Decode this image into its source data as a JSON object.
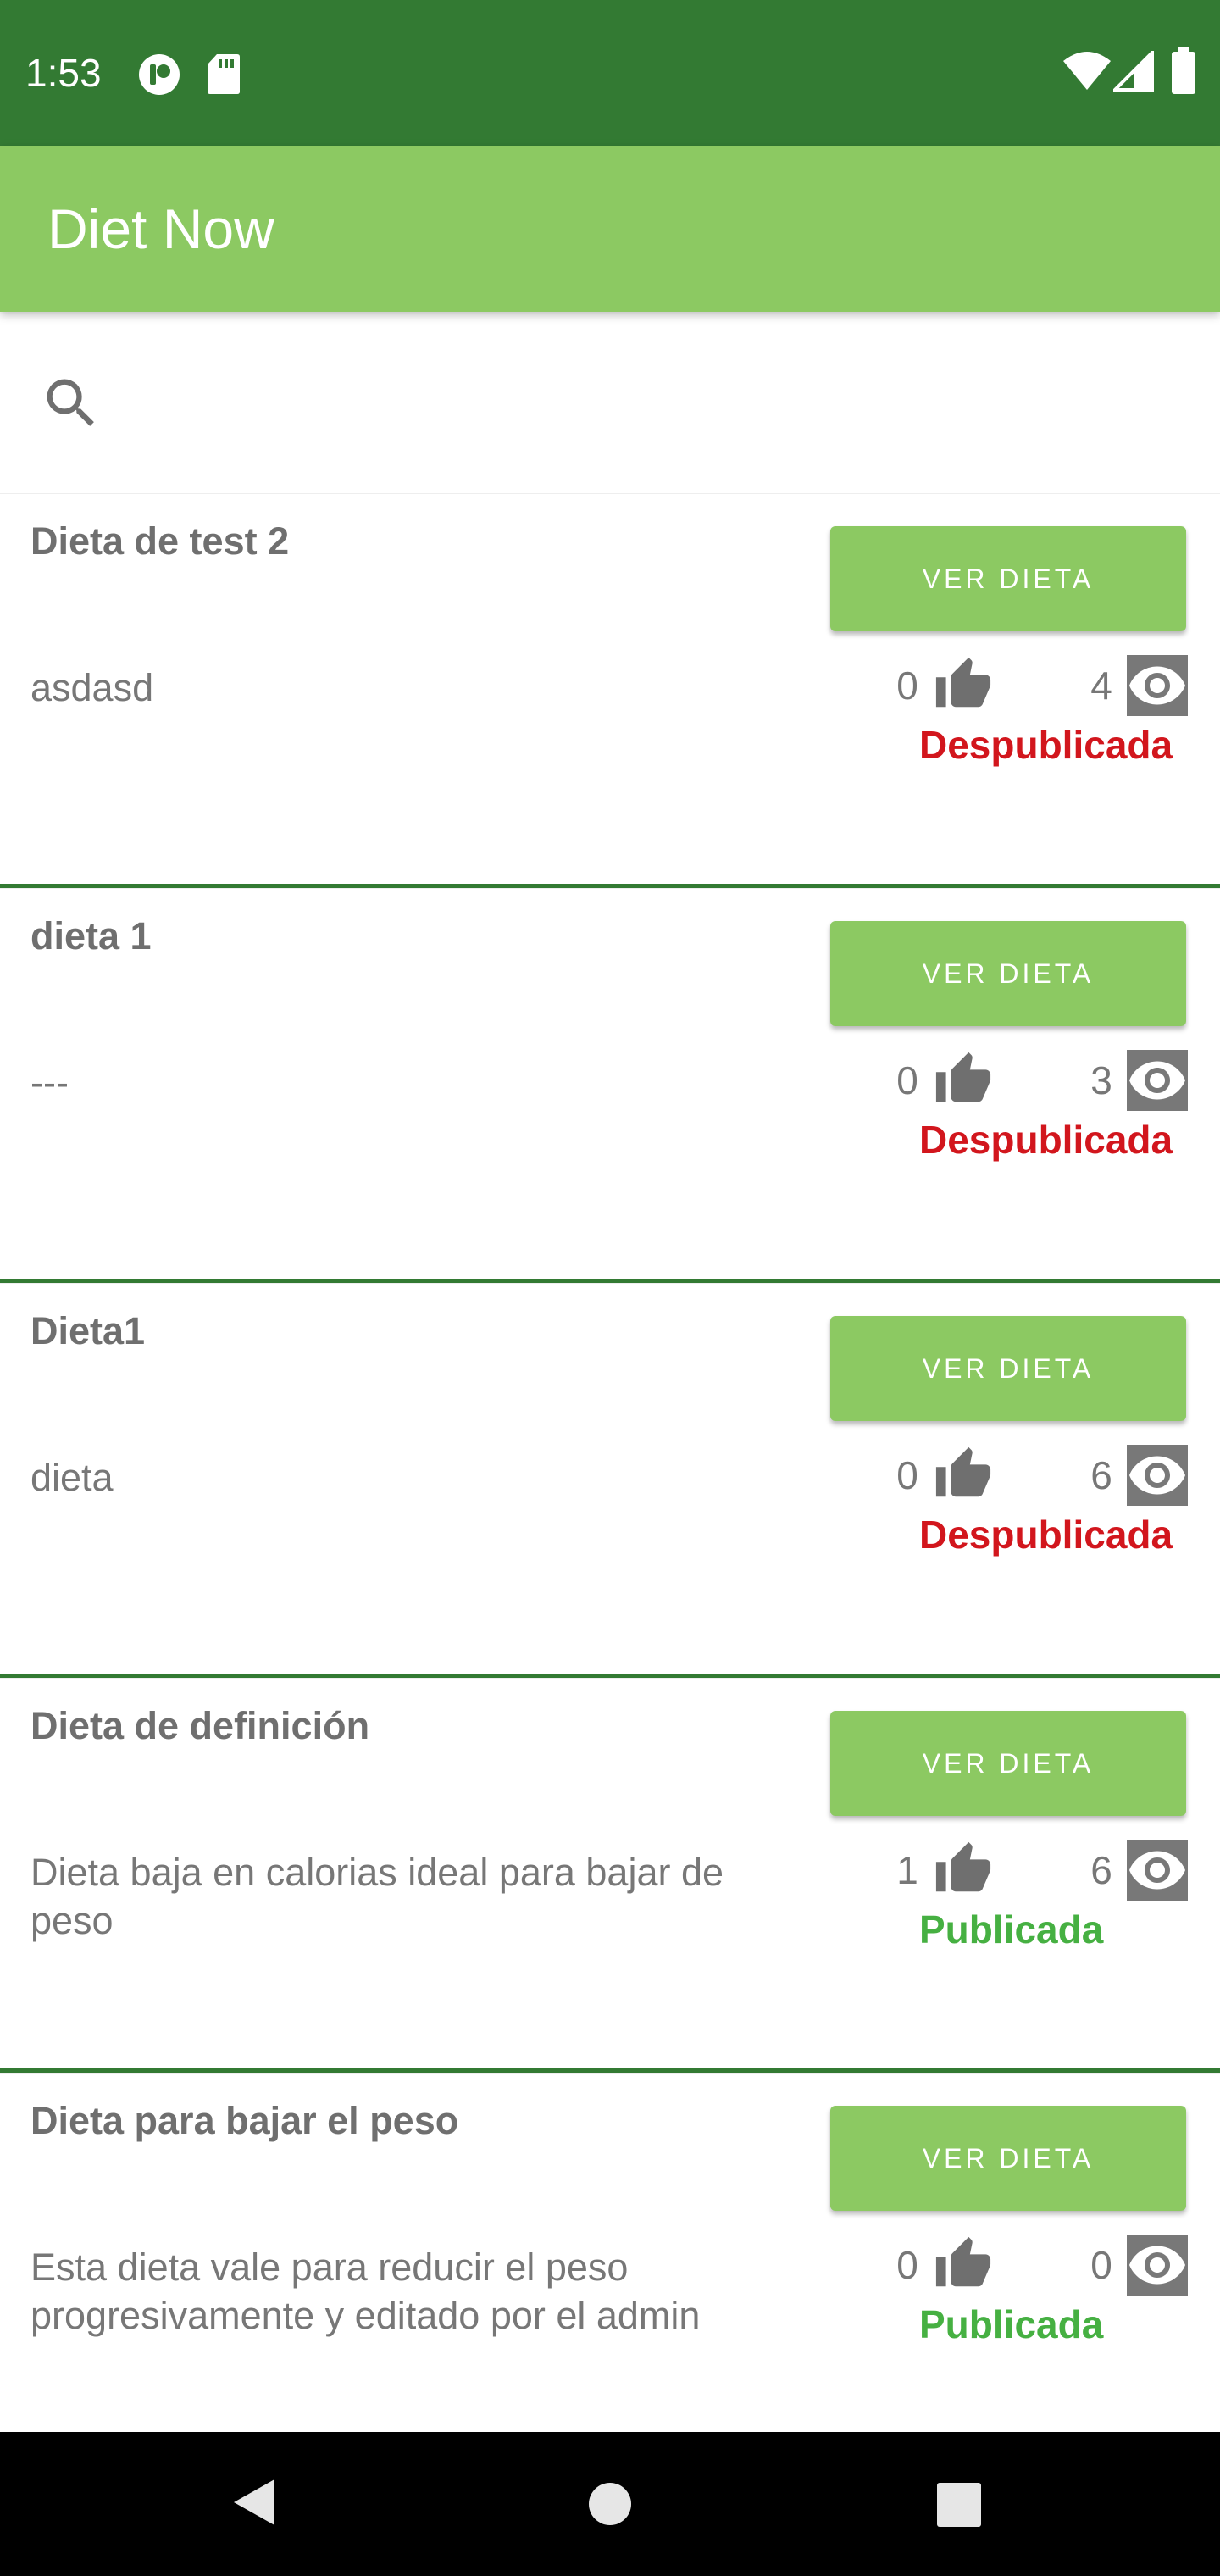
{
  "status_bar": {
    "time": "1:53",
    "icons": [
      "notification-app-icon",
      "sd-card-icon",
      "wifi-icon",
      "cell-signal-icon",
      "battery-icon"
    ]
  },
  "app_bar": {
    "title": "Diet Now"
  },
  "search": {
    "placeholder": "",
    "value": ""
  },
  "colors": {
    "status_bar": "#337A33",
    "app_bar": "#8CC962",
    "button": "#8CC962",
    "divider": "#337A33",
    "unpublished": "#D2161D",
    "published": "#46B042"
  },
  "diets": [
    {
      "title": "Dieta de test 2",
      "description": "asdasd",
      "likes": "0",
      "views": "4",
      "status": "Despublicada",
      "status_color": "#D2161D",
      "button_label": "VER DIETA"
    },
    {
      "title": "dieta 1",
      "description": "---",
      "likes": "0",
      "views": "3",
      "status": "Despublicada",
      "status_color": "#D2161D",
      "button_label": "VER DIETA"
    },
    {
      "title": "Dieta1",
      "description": "dieta",
      "likes": "0",
      "views": "6",
      "status": "Despublicada",
      "status_color": "#D2161D",
      "button_label": "VER DIETA"
    },
    {
      "title": "Dieta de definición",
      "description": "Dieta baja en calorias ideal para bajar de peso",
      "likes": "1",
      "views": "6",
      "status": "Publicada",
      "status_color": "#46B042",
      "button_label": "VER DIETA"
    },
    {
      "title": "Dieta para bajar el peso",
      "description": "Esta dieta vale para reducir el peso progresivamente y editado por el admin",
      "likes": "0",
      "views": "0",
      "status": "Publicada",
      "status_color": "#46B042",
      "button_label": "VER DIETA"
    }
  ],
  "nav_bar": {
    "buttons": [
      "back-icon",
      "home-icon",
      "recents-icon"
    ]
  }
}
